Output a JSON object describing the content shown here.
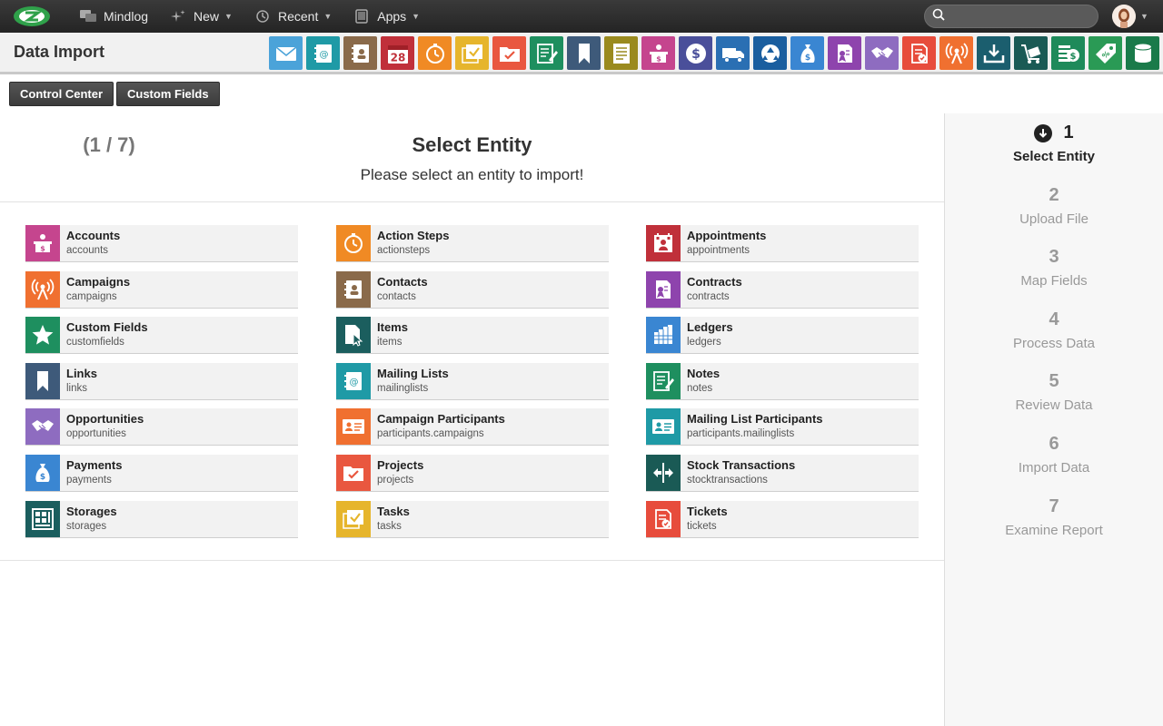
{
  "topbar": {
    "app_name": "Mindlog",
    "new_label": "New",
    "recent_label": "Recent",
    "apps_label": "Apps",
    "search_placeholder": ""
  },
  "header": {
    "title": "Data Import",
    "app_icons": [
      {
        "name": "mail-icon",
        "color": "#4ba3d9"
      },
      {
        "name": "address-book-icon",
        "color": "#1f9aa6"
      },
      {
        "name": "contacts-icon",
        "color": "#8a6a4a"
      },
      {
        "name": "calendar-icon",
        "color": "#c0303a",
        "text": "28"
      },
      {
        "name": "timer-icon",
        "color": "#f08a24"
      },
      {
        "name": "tasks-icon",
        "color": "#e6b52c"
      },
      {
        "name": "projects-icon",
        "color": "#e9573f"
      },
      {
        "name": "notes-icon",
        "color": "#1e8f5f"
      },
      {
        "name": "bookmark-icon",
        "color": "#3e5a7a"
      },
      {
        "name": "document-icon",
        "color": "#9a8a1e"
      },
      {
        "name": "accounts-icon",
        "color": "#c5458e"
      },
      {
        "name": "dollar-icon",
        "color": "#4a4f9a"
      },
      {
        "name": "truck-icon",
        "color": "#2a6fb3"
      },
      {
        "name": "recycle-icon",
        "color": "#1a5e9f"
      },
      {
        "name": "money-bag-icon",
        "color": "#3a86d2"
      },
      {
        "name": "contract-icon",
        "color": "#8e44ad"
      },
      {
        "name": "handshake-icon",
        "color": "#8e6cc0"
      },
      {
        "name": "invoice-icon",
        "color": "#e74c3c"
      },
      {
        "name": "broadcast-icon",
        "color": "#f07030"
      },
      {
        "name": "download-icon",
        "color": "#1b5e6e"
      },
      {
        "name": "cart-icon",
        "color": "#1a5a55"
      },
      {
        "name": "cash-icon",
        "color": "#1e8a5a"
      },
      {
        "name": "tag-icon",
        "color": "#2a9a55"
      },
      {
        "name": "database-icon",
        "color": "#1a7a4a"
      }
    ]
  },
  "toolbar": {
    "control_center_label": "Control Center",
    "custom_fields_label": "Custom Fields"
  },
  "main": {
    "title": "Select Entity",
    "step_indicator": "(1 / 7)",
    "subtitle": "Please select an entity to import!",
    "entities": [
      {
        "name": "Accounts",
        "key": "accounts",
        "icon": "accounts-icon",
        "color": "#c5458e"
      },
      {
        "name": "Action Steps",
        "key": "actionsteps",
        "icon": "timer-icon",
        "color": "#f08a24"
      },
      {
        "name": "Appointments",
        "key": "appointments",
        "icon": "appointment-icon",
        "color": "#c0303a"
      },
      {
        "name": "Campaigns",
        "key": "campaigns",
        "icon": "broadcast-icon",
        "color": "#f07030"
      },
      {
        "name": "Contacts",
        "key": "contacts",
        "icon": "contacts-icon",
        "color": "#8a6a4a"
      },
      {
        "name": "Contracts",
        "key": "contracts",
        "icon": "contract-icon",
        "color": "#8e44ad"
      },
      {
        "name": "Custom Fields",
        "key": "customfields",
        "icon": "star-icon",
        "color": "#1e8f5f"
      },
      {
        "name": "Items",
        "key": "items",
        "icon": "item-icon",
        "color": "#1b5e5e"
      },
      {
        "name": "Ledgers",
        "key": "ledgers",
        "icon": "ledger-icon",
        "color": "#3a86d2"
      },
      {
        "name": "Links",
        "key": "links",
        "icon": "bookmark-icon",
        "color": "#3e5a7a"
      },
      {
        "name": "Mailing Lists",
        "key": "mailinglists",
        "icon": "address-book-icon",
        "color": "#1f9aa6"
      },
      {
        "name": "Notes",
        "key": "notes",
        "icon": "notes-icon",
        "color": "#1e8f5f"
      },
      {
        "name": "Opportunities",
        "key": "opportunities",
        "icon": "handshake-icon",
        "color": "#8e6cc0"
      },
      {
        "name": "Campaign Participants",
        "key": "participants.campaigns",
        "icon": "id-card-icon",
        "color": "#f07030"
      },
      {
        "name": "Mailing List Participants",
        "key": "participants.mailinglists",
        "icon": "id-card-icon",
        "color": "#1f9aa6"
      },
      {
        "name": "Payments",
        "key": "payments",
        "icon": "money-bag-icon",
        "color": "#3a86d2"
      },
      {
        "name": "Projects",
        "key": "projects",
        "icon": "projects-icon",
        "color": "#e9573f"
      },
      {
        "name": "Stock Transactions",
        "key": "stocktransactions",
        "icon": "transfer-icon",
        "color": "#1a5a55"
      },
      {
        "name": "Storages",
        "key": "storages",
        "icon": "storage-icon",
        "color": "#1b5e5e"
      },
      {
        "name": "Tasks",
        "key": "tasks",
        "icon": "tasks-icon",
        "color": "#e6b52c"
      },
      {
        "name": "Tickets",
        "key": "tickets",
        "icon": "invoice-icon",
        "color": "#e74c3c"
      }
    ]
  },
  "steps": [
    {
      "num": "1",
      "label": "Select Entity",
      "active": true
    },
    {
      "num": "2",
      "label": "Upload File"
    },
    {
      "num": "3",
      "label": "Map Fields"
    },
    {
      "num": "4",
      "label": "Process Data"
    },
    {
      "num": "5",
      "label": "Review Data"
    },
    {
      "num": "6",
      "label": "Import Data"
    },
    {
      "num": "7",
      "label": "Examine Report"
    }
  ]
}
